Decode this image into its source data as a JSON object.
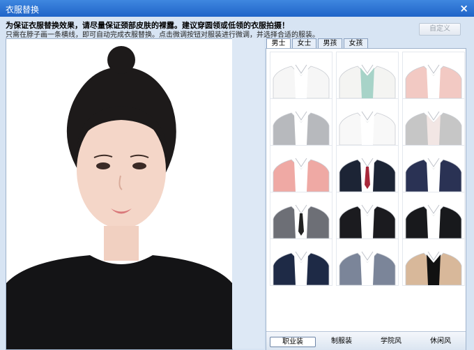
{
  "window": {
    "title": "衣服替换",
    "close_glyph": "×"
  },
  "instructions": {
    "line1": "为保证衣服替换效果，请尽量保证颈部皮肤的裸露。建议穿圆领或低领的衣服拍摄！",
    "line2": "只需在脖子画一条横线，即可自动完成衣服替换。点击微调按钮对服装进行微调，并选择合适的服装。"
  },
  "custom_button": {
    "label": "自定义"
  },
  "tabs": [
    {
      "label": "男士",
      "active": true
    },
    {
      "label": "女士",
      "active": false
    },
    {
      "label": "男孩",
      "active": false
    },
    {
      "label": "女孩",
      "active": false
    }
  ],
  "outfits": [
    {
      "icon": "white-shirt",
      "color": "#f6f6f6",
      "under": "#ffffff",
      "tie": false
    },
    {
      "icon": "white-blazer-mint-top",
      "color": "#f4f4f2",
      "under": "#a7d3c8",
      "tie": false
    },
    {
      "icon": "pink-blazer",
      "color": "#f2c9c3",
      "under": "#ffffff",
      "tie": false
    },
    {
      "icon": "grey-vest",
      "color": "#b7b9bd",
      "under": "#ffffff",
      "tie": false
    },
    {
      "icon": "white-blouse",
      "color": "#f8f8f8",
      "under": "#ffffff",
      "tie": false
    },
    {
      "icon": "grey-jacket-bow",
      "color": "#c6c6c6",
      "under": "#f2e6e4",
      "tie": false
    },
    {
      "icon": "pink-blazer-white",
      "color": "#efa9a4",
      "under": "#ffffff",
      "tie": false
    },
    {
      "icon": "navy-suit-red-tie",
      "color": "#1c2435",
      "under": "#ffffff",
      "tie": true,
      "tie_color": "#a8283a"
    },
    {
      "icon": "navy-pinstripe-suit",
      "color": "#2a3254",
      "under": "#ffffff",
      "tie": false
    },
    {
      "icon": "grey-suit-black-tie",
      "color": "#6d6f76",
      "under": "#ffffff",
      "tie": true,
      "tie_color": "#222222"
    },
    {
      "icon": "black-suit-white-trim",
      "color": "#1b1b1f",
      "under": "#ffffff",
      "tie": false
    },
    {
      "icon": "black-suit-white-shirt",
      "color": "#18191c",
      "under": "#ffffff",
      "tie": false
    },
    {
      "icon": "navy-suit-white-shirt",
      "color": "#1e2a46",
      "under": "#ffffff",
      "tie": false
    },
    {
      "icon": "grey-blue-blazer",
      "color": "#7b8599",
      "under": "#ffffff",
      "tie": false
    },
    {
      "icon": "beige-blazer-black-top",
      "color": "#d8b89a",
      "under": "#111111",
      "tie": false
    }
  ],
  "categories": [
    {
      "label": "职业装",
      "active": true
    },
    {
      "label": "制服装",
      "active": false
    },
    {
      "label": "学院风",
      "active": false
    },
    {
      "label": "休闲风",
      "active": false
    }
  ]
}
